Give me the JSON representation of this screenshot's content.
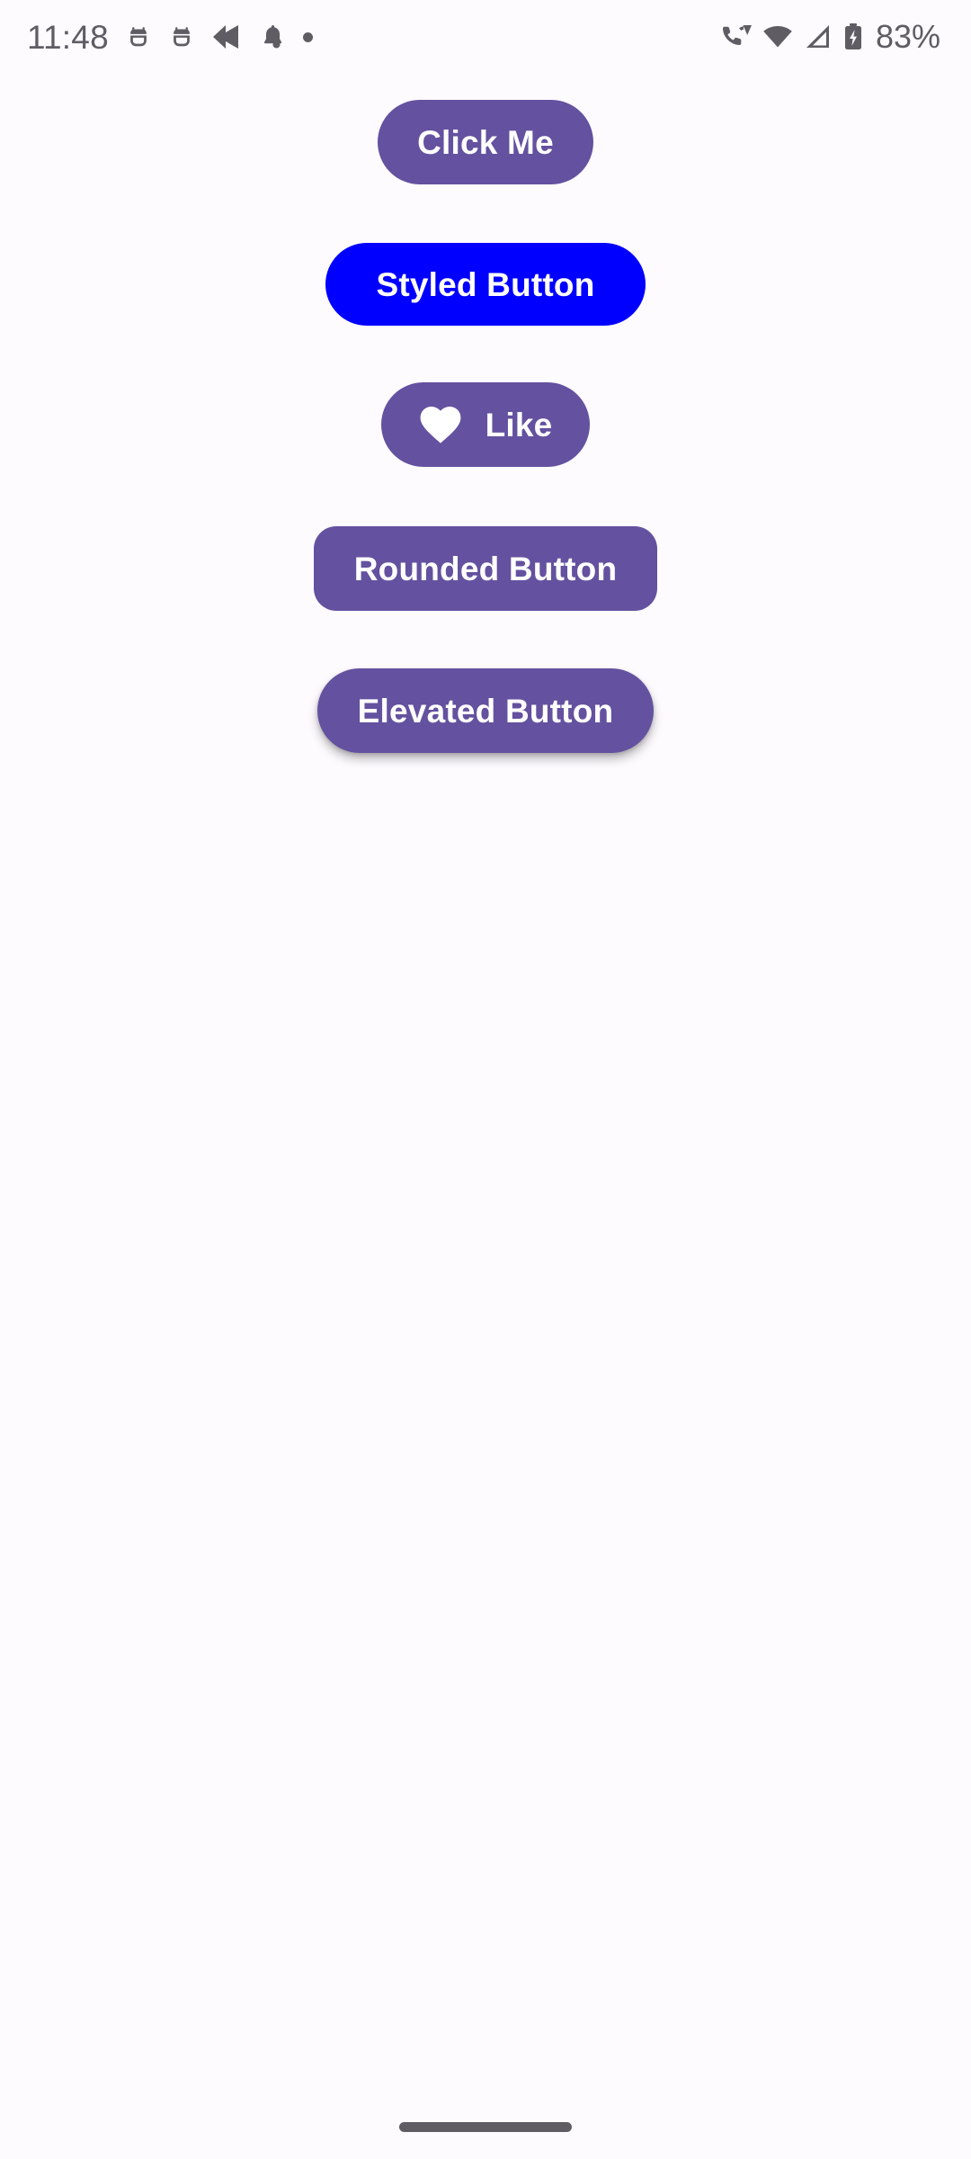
{
  "status_bar": {
    "time": "11:48",
    "battery_percent": "83%",
    "left_icons": [
      {
        "name": "android-notification-icon-1"
      },
      {
        "name": "android-notification-icon-2"
      },
      {
        "name": "back-arrow-icon"
      },
      {
        "name": "notification-bell-icon"
      },
      {
        "name": "notification-dot-icon"
      }
    ],
    "right_icons": [
      {
        "name": "phone-wifi-calling-icon"
      },
      {
        "name": "wifi-icon"
      },
      {
        "name": "cellular-signal-icon"
      },
      {
        "name": "battery-charging-icon"
      }
    ]
  },
  "colors": {
    "background": "#FEFBFF",
    "primary_purple": "#64519F",
    "styled_blue": "#0000FF",
    "on_primary": "#FFFFFF",
    "status_text": "#5F5D63",
    "nav_pill": "#5F5D63"
  },
  "buttons": [
    {
      "id": "click-me",
      "label": "Click Me",
      "shape": "pill",
      "background": "#64519F",
      "has_icon": false,
      "elevated": false
    },
    {
      "id": "styled-button",
      "label": "Styled Button",
      "shape": "pill",
      "background": "#0000FF",
      "has_icon": false,
      "elevated": false
    },
    {
      "id": "like",
      "label": "Like",
      "shape": "pill",
      "background": "#64519F",
      "has_icon": true,
      "icon": "heart-icon",
      "elevated": false
    },
    {
      "id": "rounded-button",
      "label": "Rounded Button",
      "shape": "rounded-rect",
      "background": "#64519F",
      "has_icon": false,
      "elevated": false
    },
    {
      "id": "elevated-button",
      "label": "Elevated Button",
      "shape": "pill",
      "background": "#64519F",
      "has_icon": false,
      "elevated": true
    }
  ],
  "navigation_bar": {
    "type": "gesture-pill"
  }
}
